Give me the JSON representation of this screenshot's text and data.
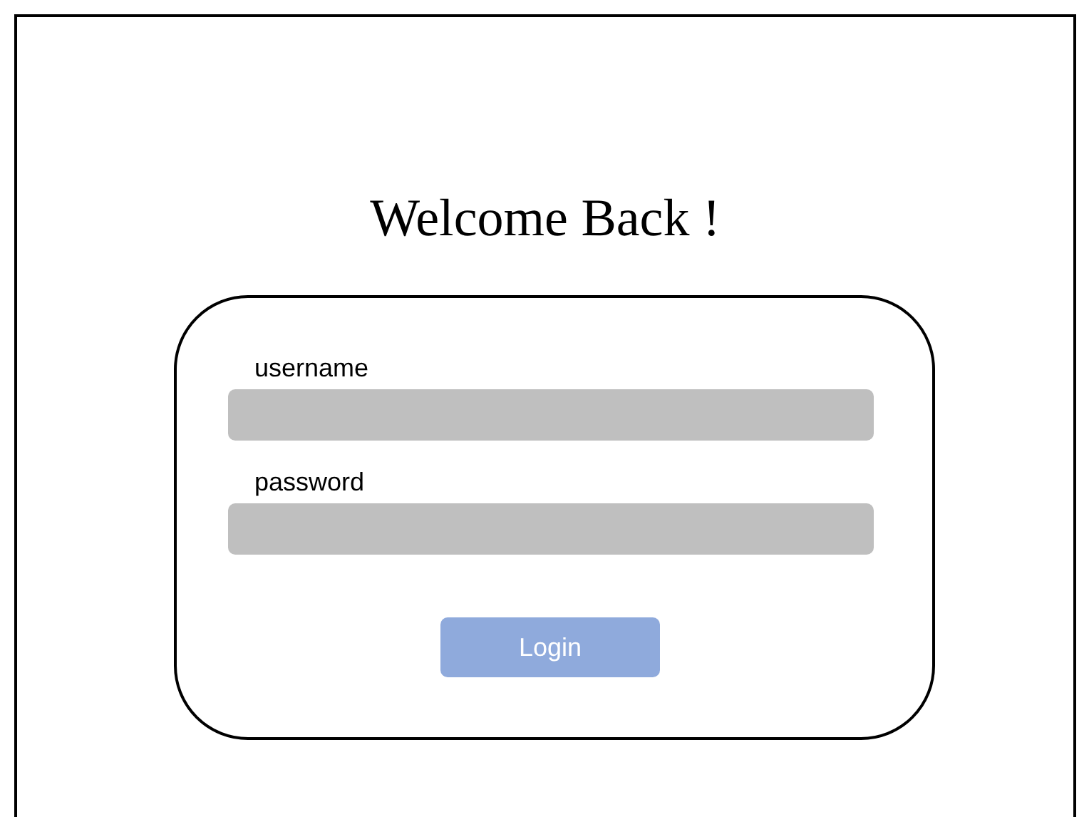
{
  "title": "Welcome Back !",
  "fields": [
    {
      "label": "username"
    },
    {
      "label": "password"
    }
  ],
  "button": {
    "label": "Login"
  }
}
